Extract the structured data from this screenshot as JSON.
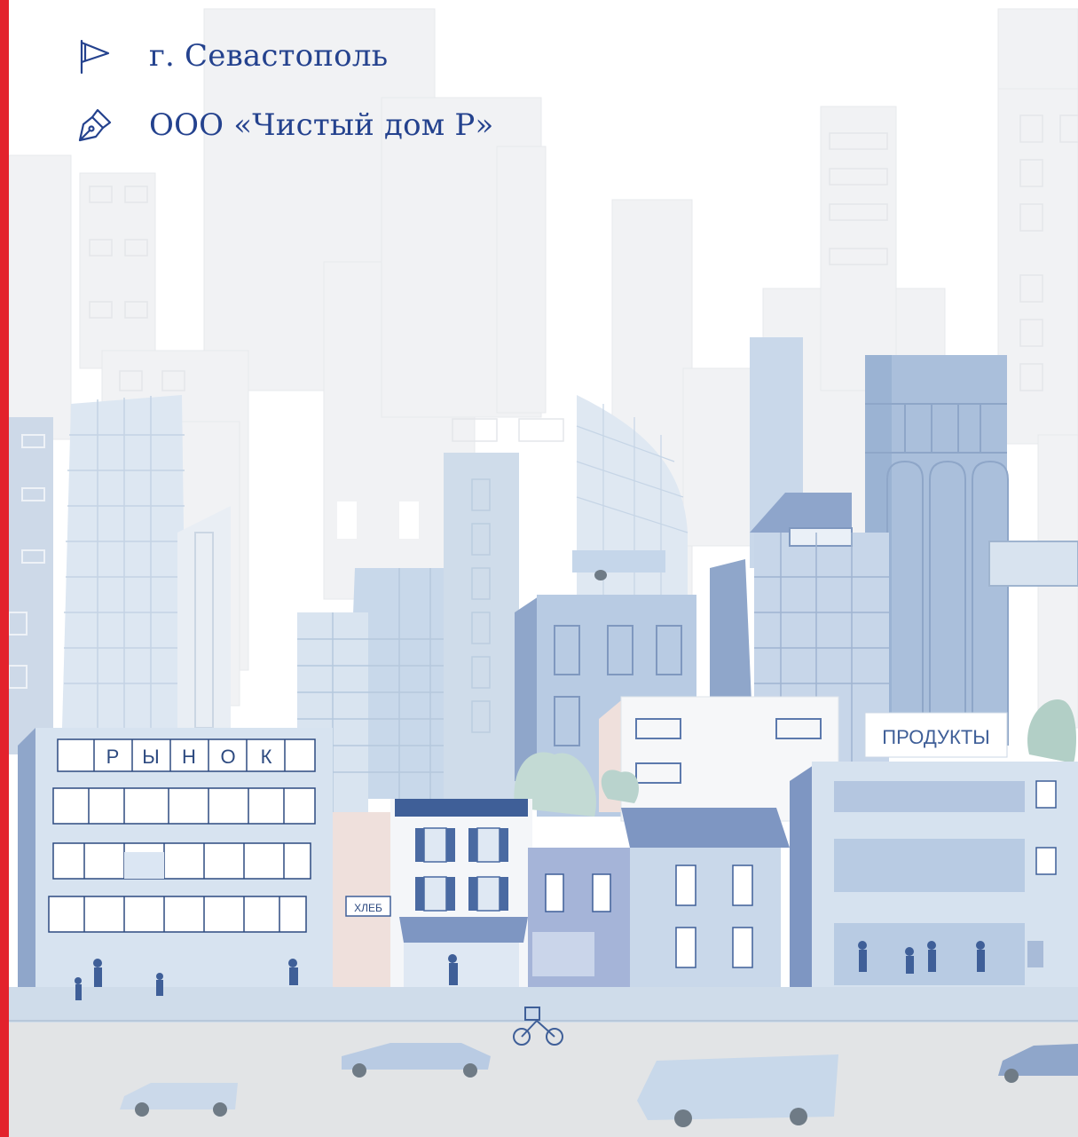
{
  "colors": {
    "accent_red": "#e3222c",
    "text_blue": "#24428e",
    "sky": "#ffffff",
    "road": "#e2e4e6",
    "sidewalk": "#cfdcea"
  },
  "info": {
    "city": {
      "icon": "flag-icon",
      "label": "г. Севастополь"
    },
    "company": {
      "icon": "fountain-pen-icon",
      "label": "ООО «Чистый дом Р»"
    }
  },
  "signs": {
    "market_letters": [
      "Р",
      "Ы",
      "Н",
      "О",
      "К"
    ],
    "bakery": "ХЛЕБ",
    "grocery": "ПРОДУКТЫ"
  }
}
